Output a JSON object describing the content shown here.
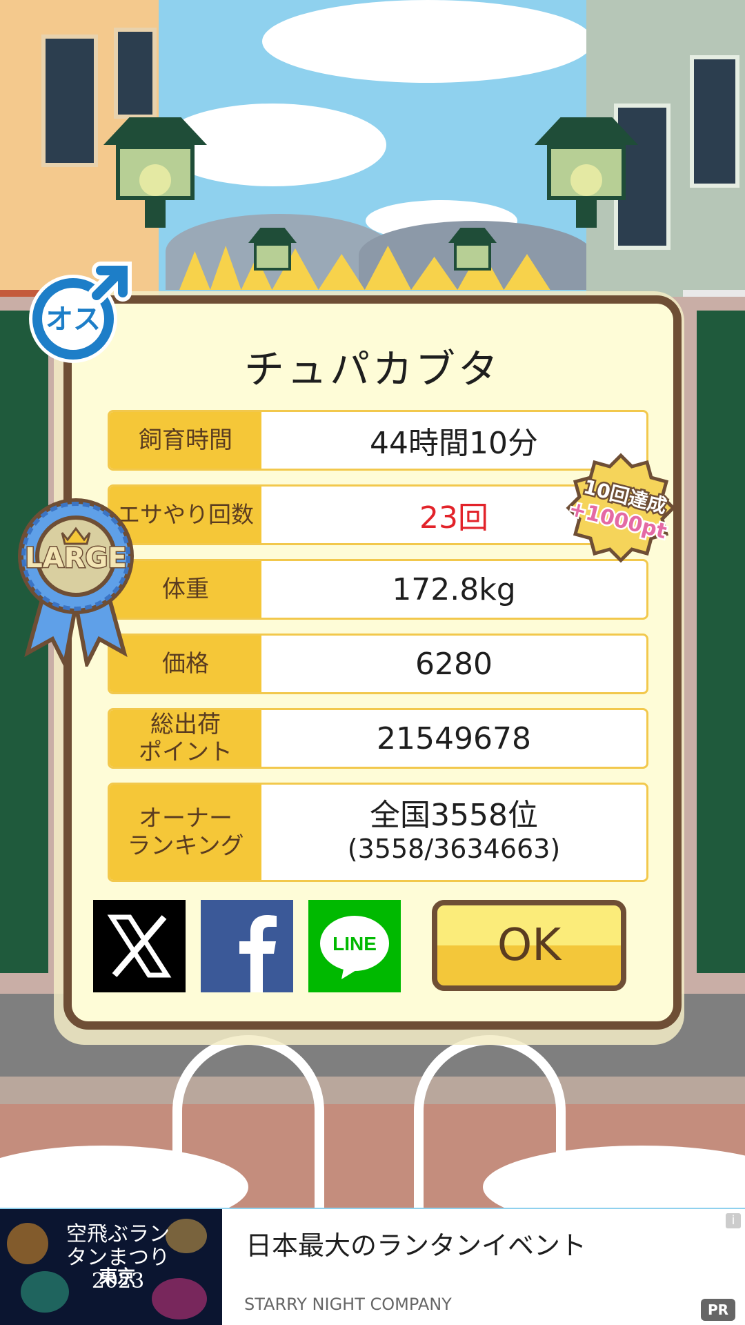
{
  "dialog": {
    "title": "チュパカブタ",
    "gender_badge": "オス",
    "size_ribbon": "LARGE",
    "achievement_badge": {
      "line1": "10回達成",
      "line2": "+1000pt"
    },
    "rows": [
      {
        "label": "飼育時間",
        "value": "44時間10分"
      },
      {
        "label": "エサやり回数",
        "value": "23回",
        "value_color": "#e2232a"
      },
      {
        "label": "体重",
        "value": "172.8kg"
      },
      {
        "label": "価格",
        "value": "6280"
      },
      {
        "label_line1": "総出荷",
        "label_line2": "ポイント",
        "value": "21549678"
      },
      {
        "label_line1": "オーナー",
        "label_line2": "ランキング",
        "value": "全国3558位",
        "value_sub": "(3558/3634663)"
      }
    ],
    "share": [
      {
        "name": "X",
        "icon": "x-logo-icon",
        "bg": "#000000"
      },
      {
        "name": "Facebook",
        "icon": "facebook-logo-icon",
        "bg": "#3b5998"
      },
      {
        "name": "LINE",
        "icon": "line-logo-icon",
        "bg": "#00b900",
        "text": "LINE"
      }
    ],
    "ok_label": "OK"
  },
  "ad": {
    "image_text": "空飛ぶランタンまつり 2023",
    "image_city": "東京",
    "title": "日本最大のランタンイベント",
    "company": "STARRY NIGHT COMPANY",
    "info_label": "i",
    "pr_label": "PR"
  }
}
